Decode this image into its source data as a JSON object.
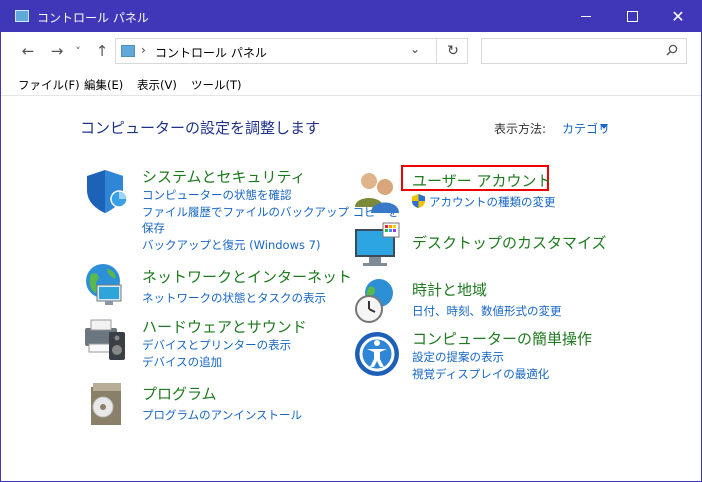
{
  "window": {
    "title": "コントロール パネル"
  },
  "titlebar_buttons": {
    "minimize": "minimize",
    "maximize": "maximize",
    "close": "✕"
  },
  "nav": {
    "back": "←",
    "forward": "→",
    "recent": "˅",
    "up": "↑",
    "address_sep": "›",
    "address_path": "コントロール パネル",
    "address_dropdown": "⌄",
    "refresh": "↻",
    "search_placeholder": ""
  },
  "menu": [
    "ファイル(F)",
    "編集(E)",
    "表示(V)",
    "ツール(T)"
  ],
  "heading": "コンピューターの設定を調整します",
  "view_by": {
    "label": "表示方法:",
    "value": "カテゴリ"
  },
  "categories_left": [
    {
      "icon": "security-shield-icon",
      "title": "システムとセキュリティ",
      "links": [
        "コンピューターの状態を確認",
        "ファイル履歴でファイルのバックアップ コピーを",
        "保存",
        "バックアップと復元 (Windows 7)"
      ]
    },
    {
      "icon": "network-globe-icon",
      "title": "ネットワークとインターネット",
      "links": [
        "ネットワークの状態とタスクの表示"
      ]
    },
    {
      "icon": "printer-speaker-icon",
      "title": "ハードウェアとサウンド",
      "links": [
        "デバイスとプリンターの表示",
        "デバイスの追加"
      ]
    },
    {
      "icon": "programs-box-icon",
      "title": "プログラム",
      "links": [
        "プログラムのアンインストール"
      ]
    }
  ],
  "categories_right": [
    {
      "icon": "user-accounts-icon",
      "title": "ユーザー アカウント",
      "links": [
        "アカウントの種類の変更"
      ]
    },
    {
      "icon": "desktop-personalize-icon",
      "title": "デスクトップのカスタマイズ",
      "links": []
    },
    {
      "icon": "clock-globe-icon",
      "title": "時計と地域",
      "links": [
        "日付、時刻、数値形式の変更"
      ]
    },
    {
      "icon": "ease-of-access-icon",
      "title": "コンピューターの簡単操作",
      "links": [
        "設定の提案の表示",
        "視覚ディスプレイの最適化"
      ]
    }
  ],
  "colors": {
    "titlebar": "#3f36b8",
    "heading": "#1e3287",
    "category": "#1e7a1e",
    "link": "#1666c5",
    "highlight": "#e00000"
  }
}
